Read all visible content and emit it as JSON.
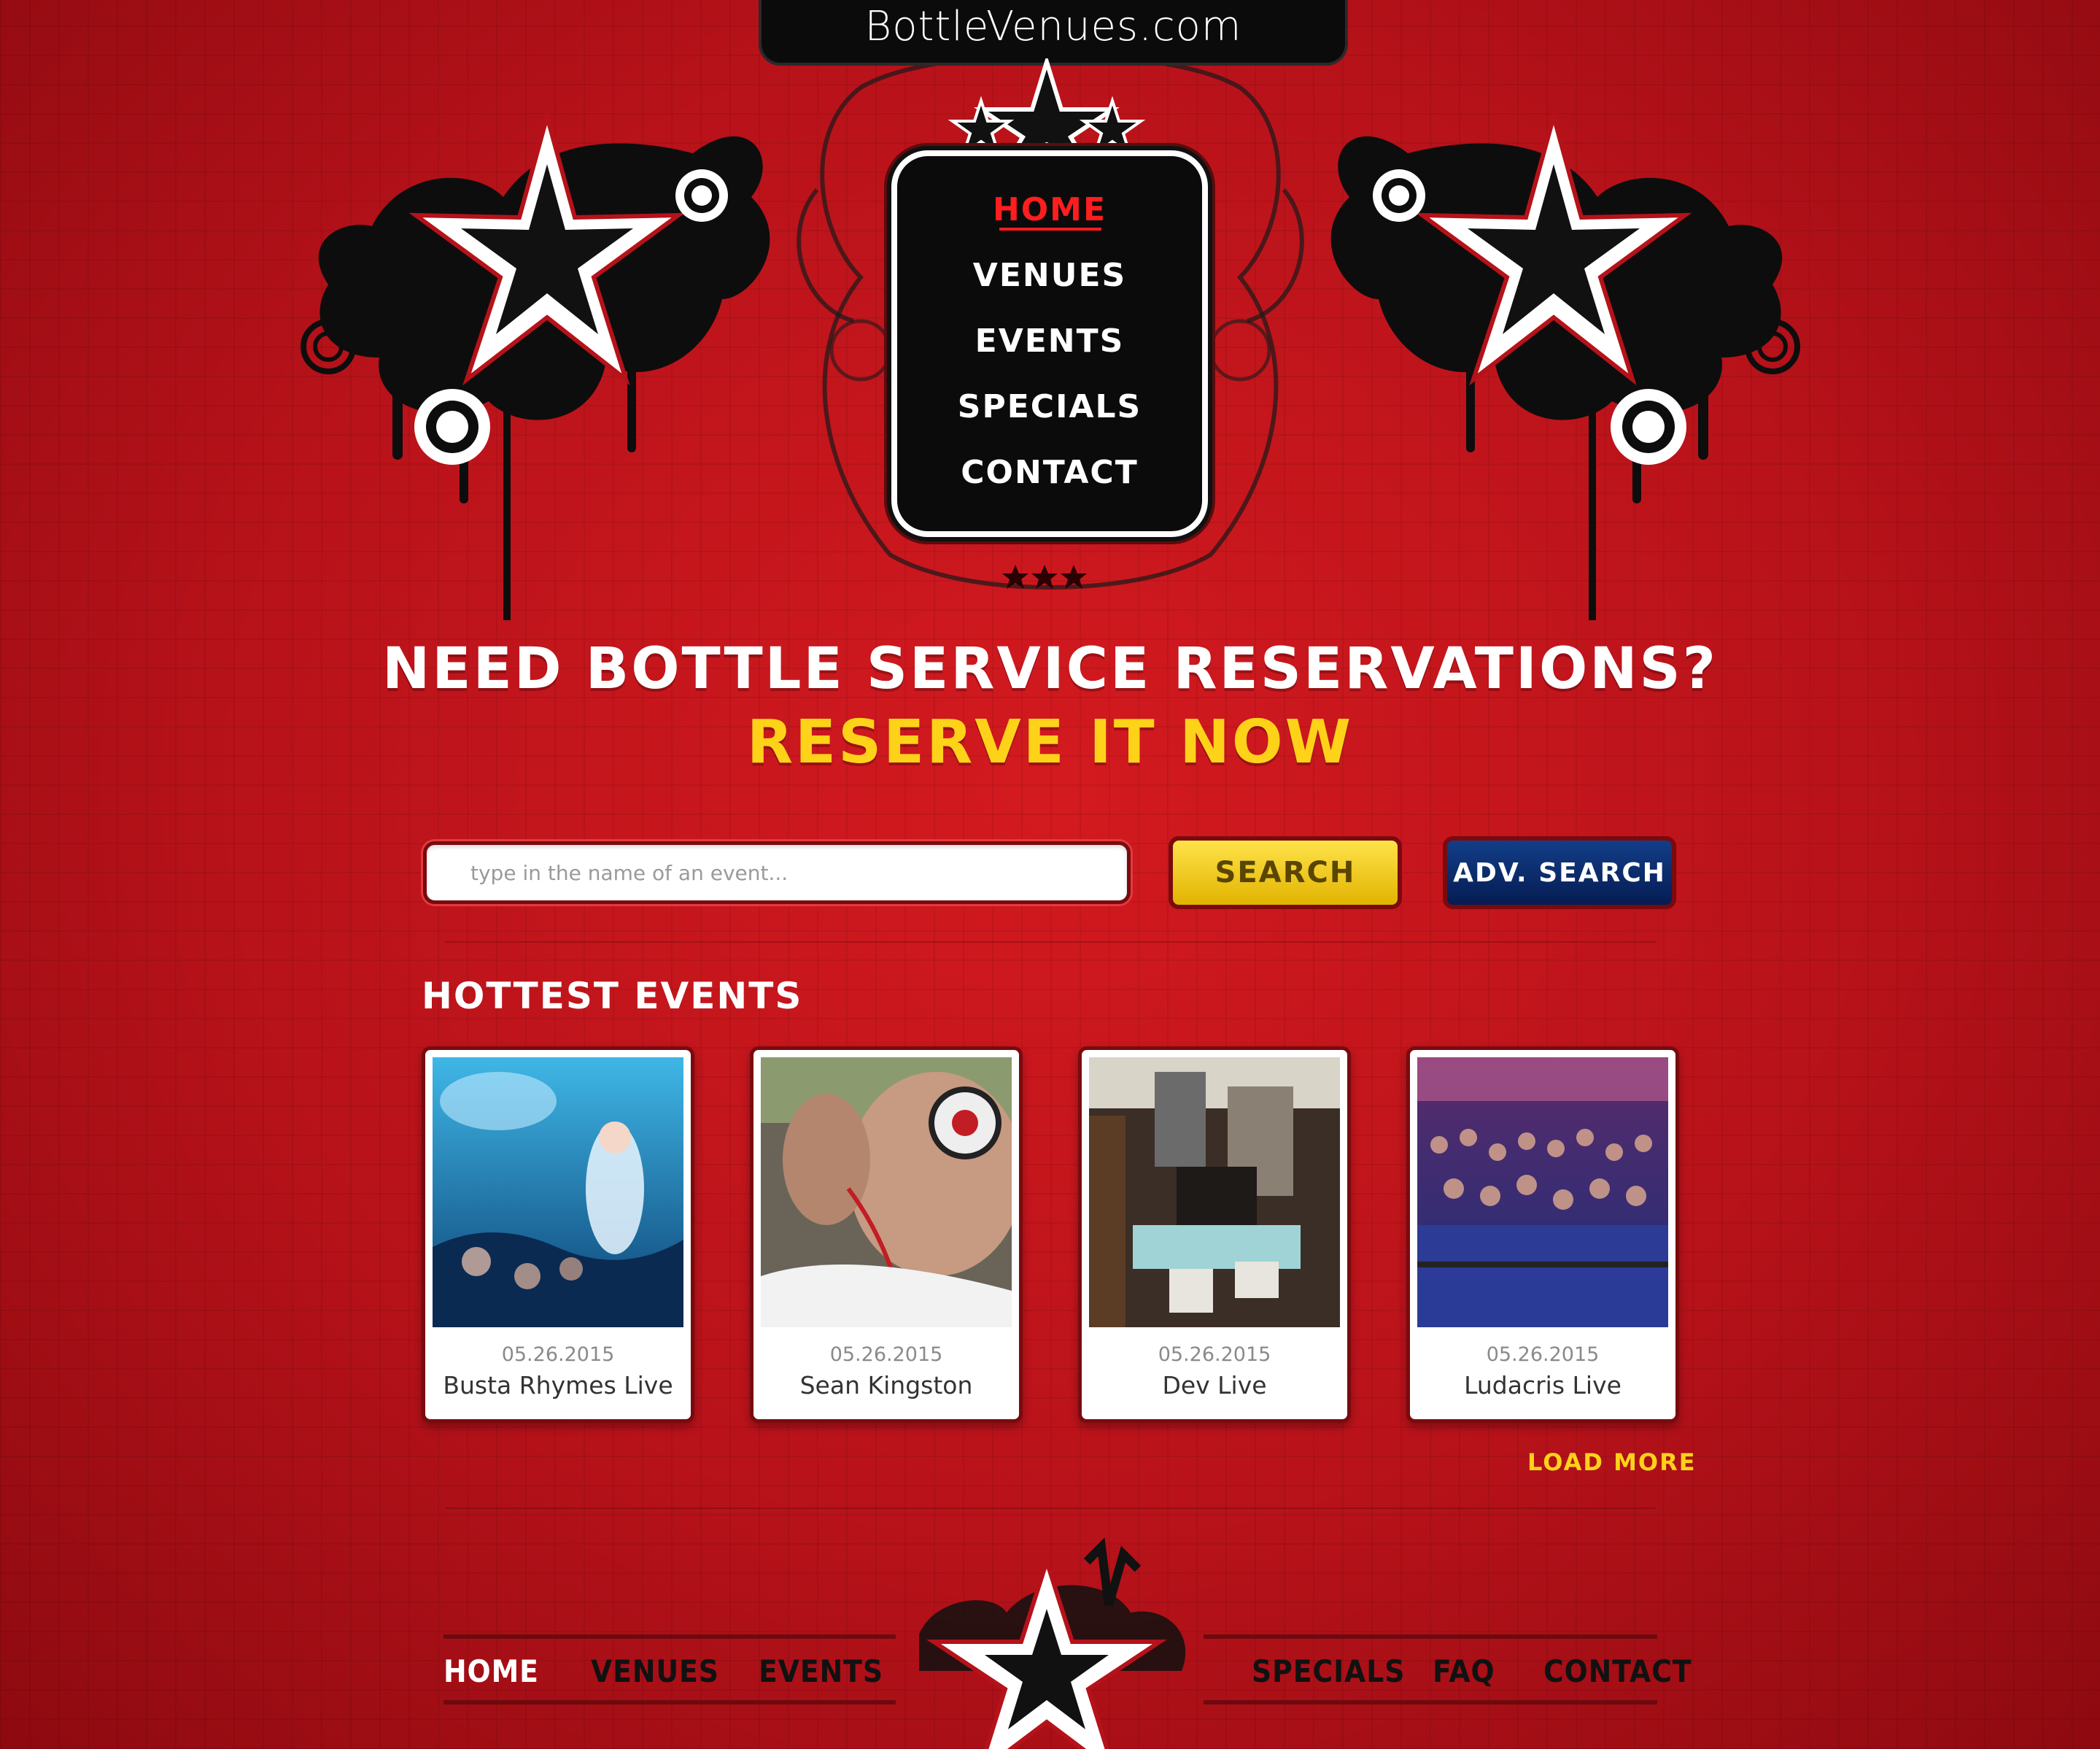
{
  "header": {
    "site_name": "BottleVenues.com"
  },
  "nav": {
    "items": [
      {
        "label": "HOME",
        "active": true
      },
      {
        "label": "VENUES",
        "active": false
      },
      {
        "label": "EVENTS",
        "active": false
      },
      {
        "label": "SPECIALS",
        "active": false
      },
      {
        "label": "CONTACT",
        "active": false
      }
    ]
  },
  "hero": {
    "line1": "NEED BOTTLE SERVICE RESERVATIONS?",
    "line2": "RESERVE IT NOW"
  },
  "search": {
    "placeholder": "type in the name of an event...",
    "value": "",
    "search_label": "SEARCH",
    "adv_search_label": "ADV. SEARCH"
  },
  "events": {
    "title": "HOTTEST EVENTS",
    "items": [
      {
        "date": "05.26.2015",
        "name": "Busta Rhymes Live",
        "image": "club-crowd-photo"
      },
      {
        "date": "05.26.2015",
        "name": "Sean Kingston",
        "image": "dj-headphones-photo"
      },
      {
        "date": "05.26.2015",
        "name": "Dev Live",
        "image": "rooftop-pool-photo"
      },
      {
        "date": "05.26.2015",
        "name": "Ludacris Live",
        "image": "concert-crowd-photo"
      }
    ],
    "load_more": "LOAD MORE"
  },
  "footer": {
    "left_links": [
      "HOME",
      "VENUES",
      "EVENTS"
    ],
    "right_links": [
      "SPECIALS",
      "FAQ",
      "CONTACT"
    ]
  },
  "colors": {
    "background": "#c0141b",
    "accent_yellow": "#ffd21a",
    "nav_active": "#ff1d1d",
    "adv_button": "#0a2a6a"
  }
}
